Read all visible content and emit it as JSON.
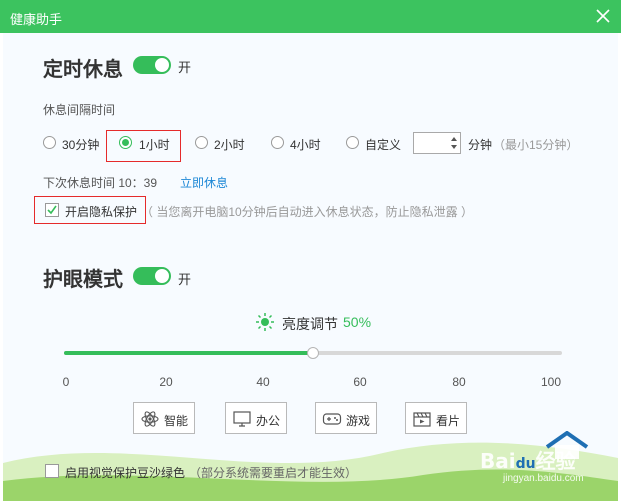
{
  "window": {
    "title": "健康助手"
  },
  "timed_rest": {
    "title": "定时休息",
    "toggle_state": "开",
    "interval_label": "休息间隔时间",
    "options": [
      {
        "label": "30分钟",
        "selected": false
      },
      {
        "label": "1小时",
        "selected": true
      },
      {
        "label": "2小时",
        "selected": false
      },
      {
        "label": "4小时",
        "selected": false
      },
      {
        "label": "自定义",
        "selected": false
      }
    ],
    "custom_value": "",
    "custom_unit": "分钟",
    "custom_hint": "（最小15分钟）",
    "next_rest_text": "下次休息时间 10：39",
    "rest_now_link": "立即休息",
    "privacy_label": "开启隐私保护",
    "privacy_checked": true,
    "privacy_hint": "（ 当您离开电脑10分钟后自动进入休息状态，防止隐私泄露 ）"
  },
  "eye_mode": {
    "title": "护眼模式",
    "toggle_state": "开",
    "brightness_label": "亮度调节",
    "brightness_value_text": "50%",
    "brightness_value": 50,
    "ticks": [
      "0",
      "20",
      "40",
      "60",
      "80",
      "100"
    ],
    "modes": [
      {
        "label": "智能",
        "icon": "atom-icon"
      },
      {
        "label": "办公",
        "icon": "monitor-icon"
      },
      {
        "label": "游戏",
        "icon": "gamepad-icon"
      },
      {
        "label": "看片",
        "icon": "film-icon"
      }
    ]
  },
  "footer": {
    "bean_green_label": "启用视觉保护豆沙绿色",
    "bean_green_hint": "（部分系统需要重启才能生效）",
    "bean_green_checked": false
  },
  "watermark": {
    "brand": "Bai",
    "brand2": "经验",
    "url": "jingyan.baidu.com"
  },
  "colors": {
    "accent": "#35bd5a",
    "titlebar": "#3cc35f",
    "highlight_box": "#e52b2b",
    "link": "#1e88d6"
  }
}
